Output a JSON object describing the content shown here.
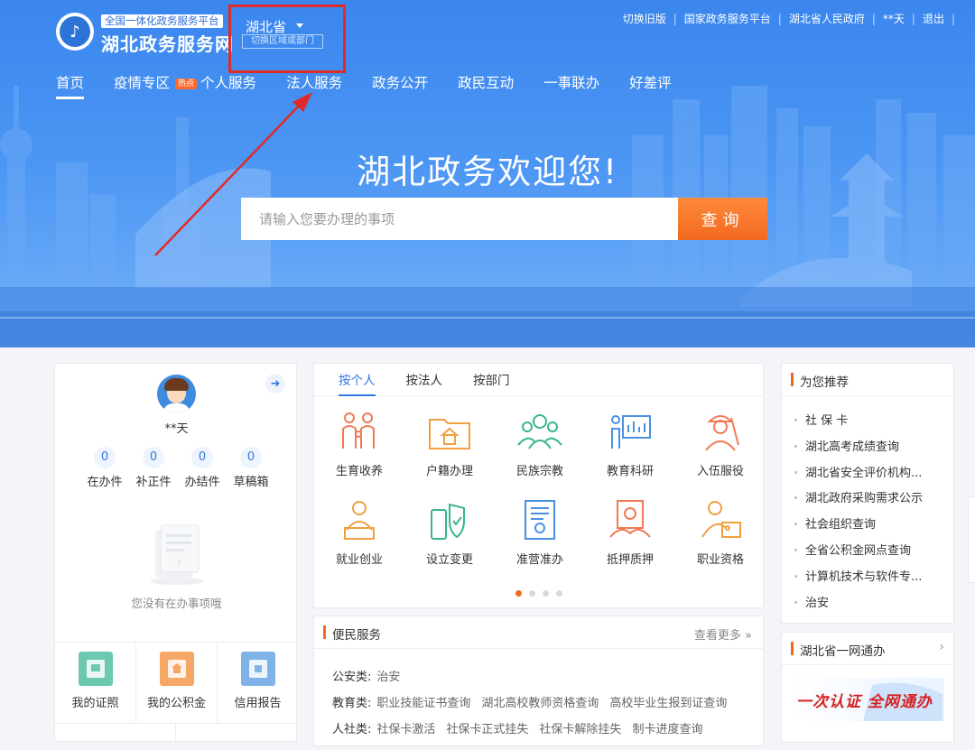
{
  "header": {
    "logo_subtitle": "全国一体化政务服务平台",
    "logo_title": "湖北政务服务网",
    "region": {
      "name": "湖北省",
      "switch_label": "切换区域或部门"
    },
    "top_links": [
      "切换旧版",
      "国家政务服务平台",
      "湖北省人民政府",
      "**天",
      "退出"
    ],
    "nav": {
      "home": "首页",
      "epidemic": "疫情专区",
      "hot_badge": "热点",
      "personal": "个人服务",
      "legal": "法人服务",
      "open": "政务公开",
      "interaction": "政民互动",
      "joint": "一事联办",
      "rating": "好差评"
    }
  },
  "hero": {
    "welcome": "湖北政务欢迎您!",
    "search_placeholder": "请输入您要办理的事项",
    "search_button": "查询"
  },
  "user": {
    "name": "**天",
    "stats": [
      {
        "num": "0",
        "label": "在办件"
      },
      {
        "num": "0",
        "label": "补正件"
      },
      {
        "num": "0",
        "label": "办结件"
      },
      {
        "num": "0",
        "label": "草稿箱"
      }
    ],
    "empty_text": "您没有在办事项哦",
    "quick_links": [
      "我的证照",
      "我的公积金",
      "信用报告"
    ]
  },
  "services": {
    "tabs": [
      "按个人",
      "按法人",
      "按部门"
    ],
    "items": [
      "生育收养",
      "户籍办理",
      "民族宗教",
      "教育科研",
      "入伍服役",
      "就业创业",
      "设立变更",
      "准营准办",
      "抵押质押",
      "职业资格"
    ]
  },
  "convenience": {
    "title": "便民服务",
    "more": "查看更多",
    "rows": [
      {
        "cat": "公安类:",
        "links": [
          "治安"
        ]
      },
      {
        "cat": "教育类:",
        "links": [
          "职业技能证书查询",
          "湖北高校教师资格查询",
          "高校毕业生报到证查询"
        ]
      },
      {
        "cat": "人社类:",
        "links": [
          "社保卡激活",
          "社保卡正式挂失",
          "社保卡解除挂失",
          "制卡进度查询"
        ]
      }
    ]
  },
  "recommend": {
    "title": "为您推荐",
    "items": [
      "社 保 卡",
      "湖北高考成绩查询",
      "湖北省安全评价机构...",
      "湖北政府采购需求公示",
      "社会组织查询",
      "全省公积金网点查询",
      "计算机技术与软件专...",
      "治安"
    ]
  },
  "one_network": {
    "title": "湖北省一网通办",
    "banner_text": "一次认证 全网通办"
  },
  "colors": {
    "accent": "#2f7ae5",
    "orange": "#f2691e",
    "highlight": "#e02a2a"
  }
}
